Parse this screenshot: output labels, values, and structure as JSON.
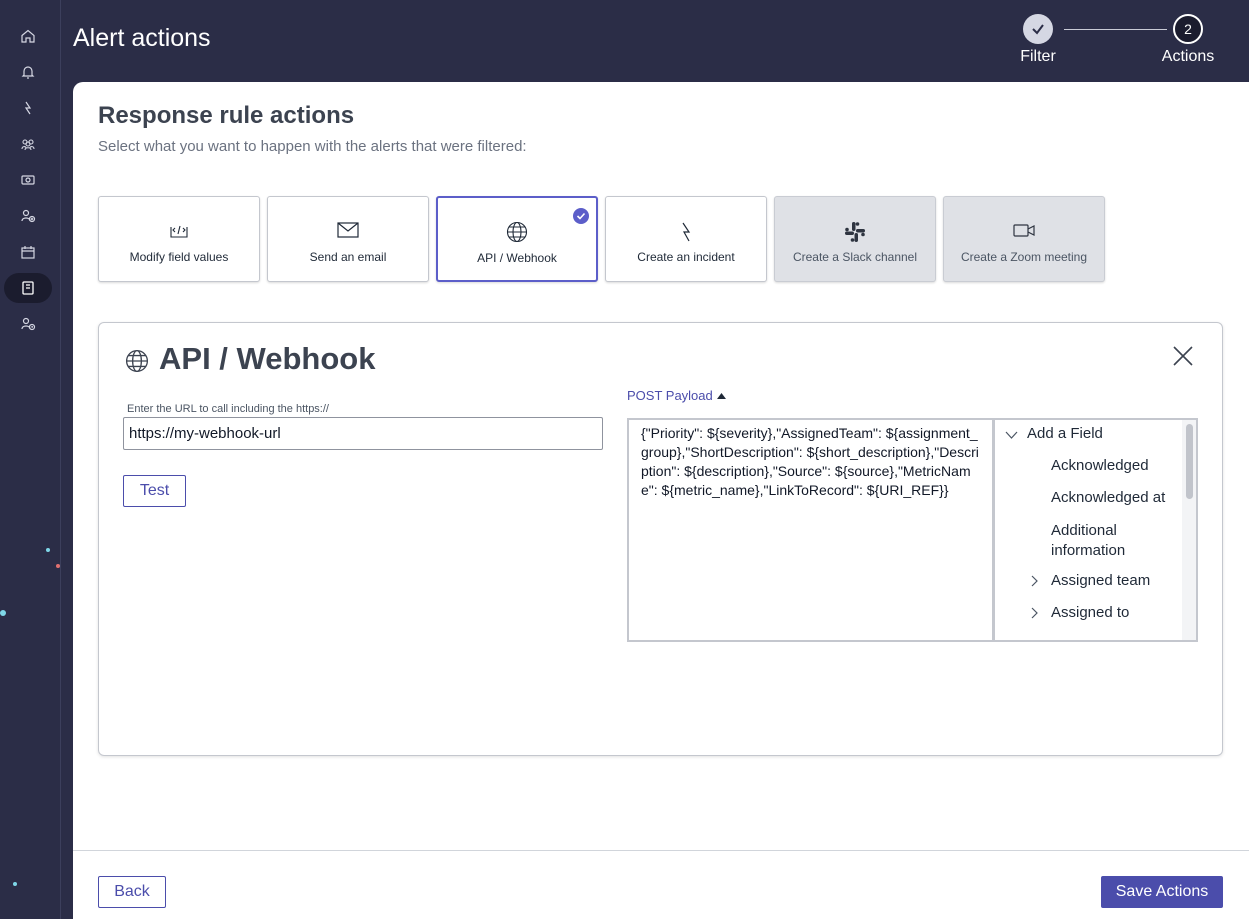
{
  "header": {
    "title": "Alert actions",
    "steps": [
      {
        "number": "1",
        "label": "Filter",
        "state": "complete"
      },
      {
        "number": "2",
        "label": "Actions",
        "state": "current"
      }
    ]
  },
  "nav": {
    "icons": [
      "home-icon",
      "bell-icon",
      "lightning-icon",
      "group-icon",
      "ticket-icon",
      "user-add-icon",
      "calendar-icon",
      "book-icon",
      "user-clock-icon"
    ],
    "active_index": 7
  },
  "page": {
    "heading": "Response rule actions",
    "subheading": "Select what you want to happen with the alerts that were filtered:"
  },
  "action_cards": [
    {
      "label": "Modify field values",
      "icon": "code-icon",
      "state": "normal"
    },
    {
      "label": "Send an email",
      "icon": "email-icon",
      "state": "normal"
    },
    {
      "label": "API / Webhook",
      "icon": "globe-icon",
      "state": "selected"
    },
    {
      "label": "Create an incident",
      "icon": "incident-icon",
      "state": "normal"
    },
    {
      "label": "Create a Slack channel",
      "icon": "slack-icon",
      "state": "disabled"
    },
    {
      "label": "Create a Zoom meeting",
      "icon": "video-icon",
      "state": "disabled"
    }
  ],
  "webhook": {
    "title": "API / Webhook",
    "url_label": "Enter the URL to call including the https://",
    "url_value": "https://my-webhook-url",
    "test_label": "Test",
    "payload_toggle": "POST Payload",
    "payload": "{\"Priority\": ${severity},\"AssignedTeam\": ${assignment_group},\"ShortDescription\": ${short_description},\"Description\": ${description},\"Source\": ${source},\"MetricName\": ${metric_name},\"LinkToRecord\": ${URI_REF}}",
    "field_list": {
      "root": "Add a Field",
      "items": [
        {
          "label": "Acknowledged",
          "expandable": false
        },
        {
          "label": "Acknowledged at",
          "expandable": false
        },
        {
          "label": "Additional information",
          "expandable": false
        },
        {
          "label": "Assigned team",
          "expandable": true
        },
        {
          "label": "Assigned to",
          "expandable": true
        }
      ]
    }
  },
  "footer": {
    "back_label": "Back",
    "save_label": "Save Actions"
  },
  "colors": {
    "nav_bg": "#2b2d47",
    "accent": "#4b4dab",
    "selected": "#5c5ec9"
  }
}
